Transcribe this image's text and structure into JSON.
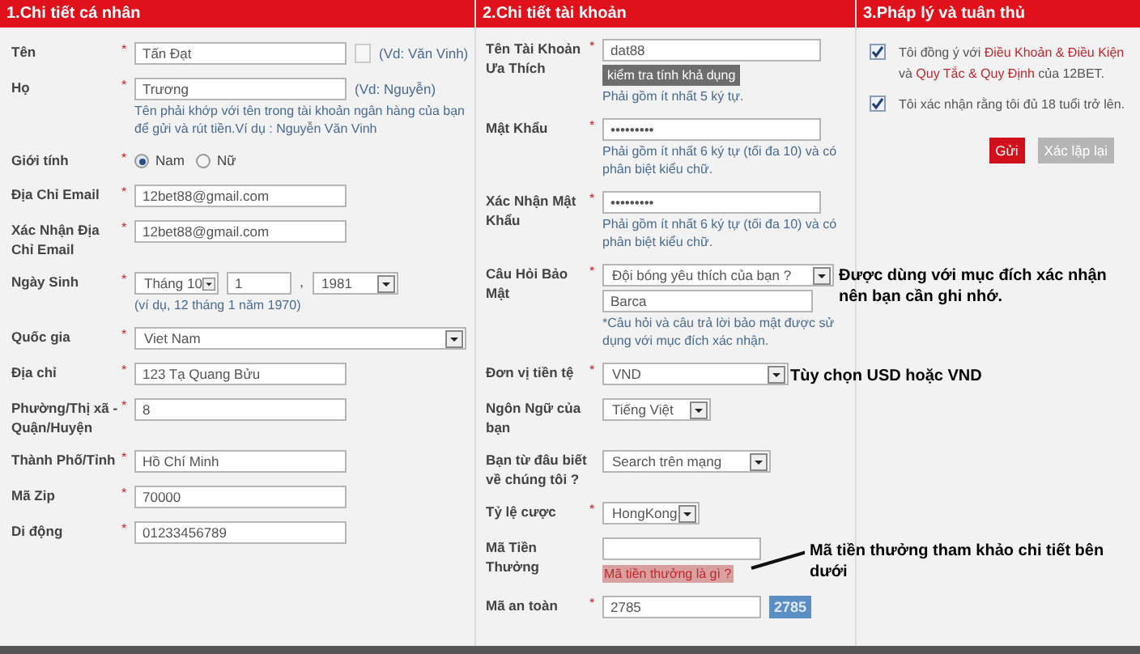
{
  "personal": {
    "title": "1.Chi tiết cá nhân",
    "fields": [
      {
        "kind": "text",
        "label": "Tên",
        "mark": "*",
        "value": "Tấn Đạt",
        "side_box": true,
        "example": "(Vd: Văn Vinh)"
      },
      {
        "kind": "text",
        "label": "Họ",
        "mark": "*",
        "value": "Trương",
        "example": "(Vd: Nguyễn)",
        "hint": "Tên phải khớp với tên trong tài khoản ngân hàng của bạn để gửi và rút tiền.Ví dụ : Nguyễn Văn Vinh"
      },
      {
        "kind": "radio",
        "label": "Giới tính",
        "mark": "*",
        "options": [
          {
            "label": "Nam",
            "selected": true
          },
          {
            "label": "Nữ",
            "selected": false
          }
        ]
      },
      {
        "kind": "text",
        "label": "Địa Chỉ Email",
        "mark": "*",
        "value": "12bet88@gmail.com"
      },
      {
        "kind": "text",
        "label": "Xác Nhận Địa Chỉ Email",
        "mark": "*",
        "value": "12bet88@gmail.com"
      },
      {
        "kind": "date",
        "label": "Ngày Sinh",
        "mark": "*",
        "month": "Tháng 10",
        "day": "1",
        "separator": ",",
        "year": "1981",
        "hint": "(ví dụ, 12 tháng 1 năm 1970)"
      },
      {
        "kind": "select",
        "label": "Quốc gia",
        "mark": "*",
        "value": "Viet Nam"
      },
      {
        "kind": "text",
        "label": "Địa chỉ",
        "mark": "*",
        "value": "123 Tạ Quang Bửu"
      },
      {
        "kind": "text",
        "label": "Phường/Thị xã - Quận/Huyện",
        "mark": "*",
        "value": "8"
      },
      {
        "kind": "text",
        "label": "Thành Phố/Tỉnh",
        "mark": "*",
        "value": "Hồ Chí Minh"
      },
      {
        "kind": "text",
        "label": "Mã Zip",
        "mark": "*",
        "value": "70000"
      },
      {
        "kind": "text",
        "label": "Di động",
        "mark": "*",
        "value": "01233456789"
      }
    ]
  },
  "account": {
    "title": "2.Chi tiết tài khoản",
    "fields": [
      {
        "kind": "text",
        "label": "Tên Tài Khoản Ưa Thích",
        "mark": "*",
        "value": "dat88",
        "button": "kiểm tra tính khả dụng",
        "hint": "Phải gồm ít nhất 5 ký tự."
      },
      {
        "kind": "text",
        "label": "Mật Khẩu",
        "mark": "*",
        "value": "•••••••••",
        "hint": "Phải gồm ít nhất 6 ký tự (tối đa 10) và có phân biệt kiểu chữ."
      },
      {
        "kind": "text",
        "label": "Xác Nhận Mật Khẩu",
        "mark": "*",
        "value": "•••••••••",
        "hint": "Phải gồm ít nhất 6 ký tự (tối đa 10) và có phân biệt kiểu chữ."
      },
      {
        "kind": "question",
        "label": "Câu Hỏi Bảo Mật",
        "mark": "*",
        "value": "Đội bóng yêu thích của bạn ?",
        "answer": "Barca",
        "hint": "*Câu hỏi và câu trả lời bảo mật được sử dụng với mục đích xác nhận."
      },
      {
        "kind": "select",
        "label": "Đơn vị tiền tệ",
        "mark": "*",
        "value": "VND"
      },
      {
        "kind": "select",
        "label": "Ngôn Ngữ của bạn",
        "value": "Tiếng Việt"
      },
      {
        "kind": "select",
        "label": "Bạn từ đâu biết về chúng tôi ?",
        "value": "Search trên mạng"
      },
      {
        "kind": "select",
        "label": "Tỷ lệ cược",
        "mark": "*",
        "value": "HongKong"
      },
      {
        "kind": "bonus",
        "label": "Mã Tiền Thưởng",
        "link": "Mã tiền thưởng là gì ?"
      },
      {
        "kind": "captcha",
        "label": "Mã an toàn",
        "mark": "*",
        "value": "2785",
        "code": "2785"
      }
    ]
  },
  "legal": {
    "title": "3.Pháp lý và tuân thủ",
    "checks": [
      {
        "checked": true,
        "parts": [
          {
            "kind": "text",
            "text": "Tôi đồng ý với "
          },
          {
            "kind": "link",
            "text": "Điều Khoản & Điều Kiện"
          },
          {
            "kind": "text",
            "text": " và "
          },
          {
            "kind": "link",
            "text": "Quy Tắc & Quy Định"
          },
          {
            "kind": "text",
            "text": " của 12BET."
          }
        ]
      },
      {
        "checked": true,
        "parts": [
          {
            "kind": "text",
            "text": "Tôi xác nhận rằng tôi đủ 18 tuổi trở lên."
          }
        ]
      }
    ],
    "buttons": [
      {
        "kind": "primary",
        "label": "Gửi"
      },
      {
        "kind": "secondary",
        "label": "Xác lập lại"
      }
    ]
  },
  "annotations": [
    {
      "kind": "question",
      "text": "Được dùng với mục đích xác nhận nên bạn cần ghi nhớ."
    },
    {
      "kind": "currency",
      "text": "Tùy chọn USD hoặc VND"
    },
    {
      "kind": "bonus",
      "text": "Mã tiền thưởng tham khảo chi tiết bên dưới"
    }
  ]
}
